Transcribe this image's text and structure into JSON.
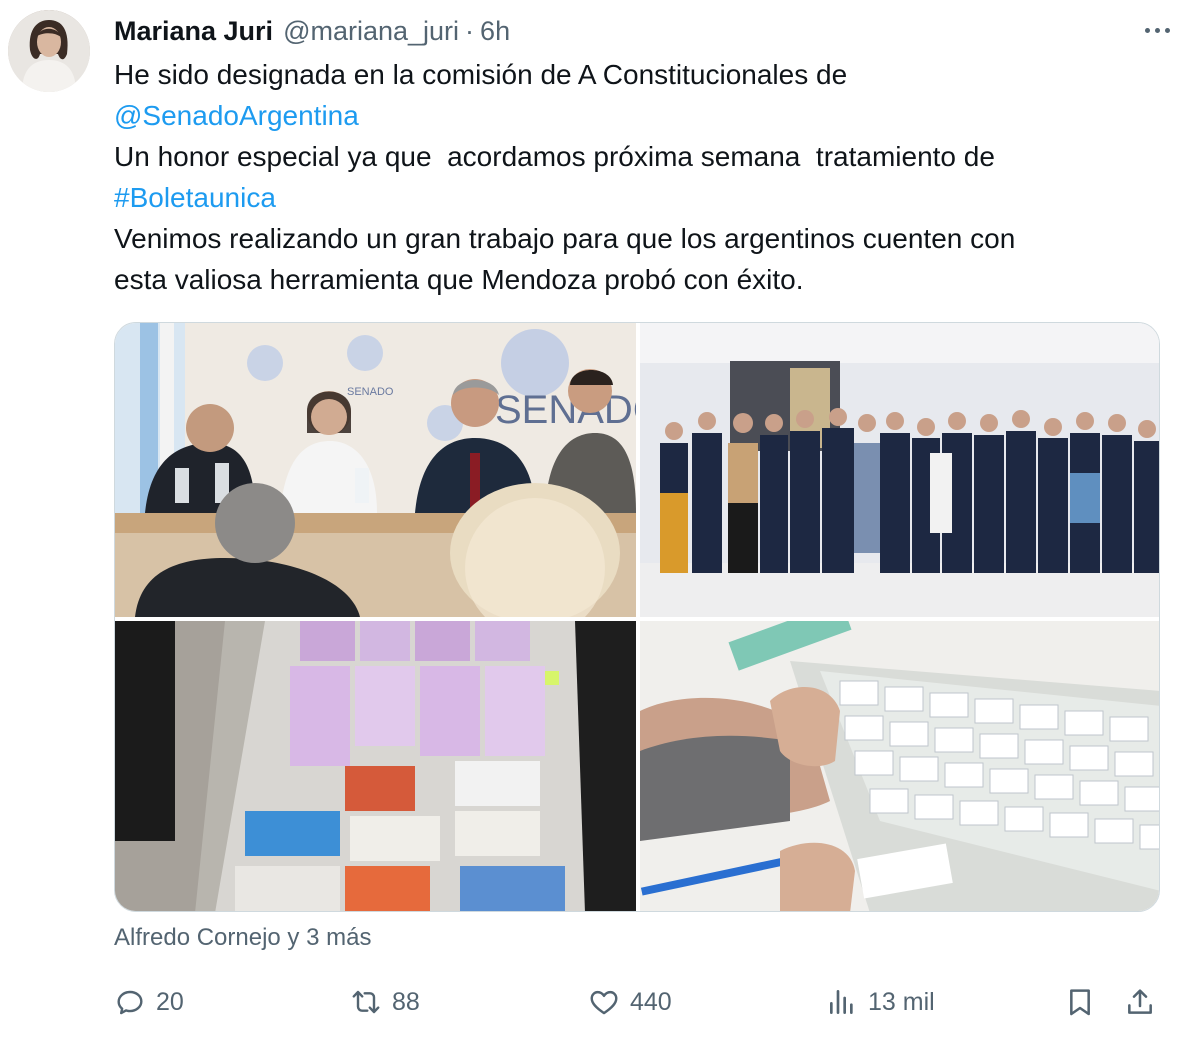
{
  "author": {
    "display_name": "Mariana Juri",
    "handle": "@mariana_juri",
    "separator": "·",
    "time": "6h"
  },
  "tweet": {
    "line1": "He sido designada en la comisión de A Constitucionales de",
    "mention": "@SenadoArgentina",
    "line3": "Un honor especial ya que  acordamos próxima semana  tratamiento de",
    "hashtag": "#Boletaunica",
    "line5": "Venimos realizando un gran trabajo para que los argentinos cuenten con",
    "line6": "esta valiosa herramienta que Mendoza probó con éxito."
  },
  "media": {
    "photo1_sign": "SENADO",
    "photo1_sign_small": "SENADO"
  },
  "tagged": "Alfredo Cornejo y 3 más",
  "actions": {
    "replies": "20",
    "retweets": "88",
    "likes": "440",
    "views": "13 mil"
  },
  "icons": {
    "more": "more-horizontal-icon",
    "reply": "reply-icon",
    "retweet": "retweet-icon",
    "like": "heart-icon",
    "views": "views-icon",
    "bookmark": "bookmark-icon",
    "share": "share-icon"
  },
  "colors": {
    "link": "#1d9bf0",
    "secondary": "#536471",
    "text": "#0f1419"
  }
}
